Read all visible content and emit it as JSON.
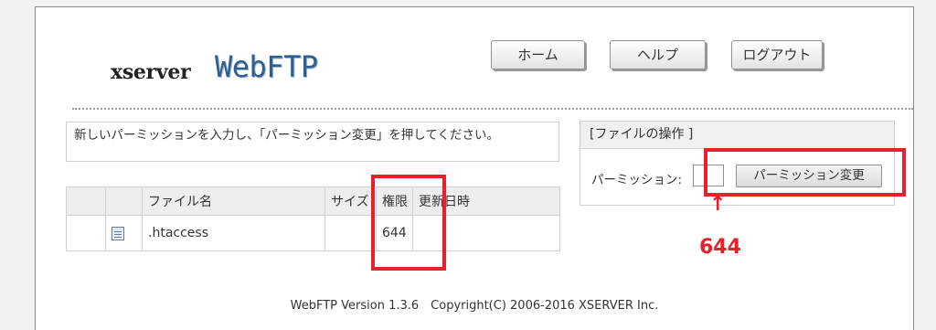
{
  "header": {
    "logo_prefix": "xserver",
    "logo_name": "WebFTP",
    "nav": {
      "home": "ホーム",
      "help": "ヘルプ",
      "logout": "ログアウト"
    }
  },
  "instruction": "新しいパーミッションを入力し、「パーミッション変更」を押してください。",
  "file_ops": {
    "title": "[ファイルの操作 ]",
    "permission_label": "パーミッション:",
    "permission_value": "",
    "change_button": "パーミッション変更"
  },
  "file_table": {
    "columns": [
      "",
      "",
      "ファイル名",
      "サイズ",
      "権限",
      "更新日時"
    ],
    "rows": [
      {
        "checkbox": "",
        "icon": "file-icon",
        "name": ".htaccess",
        "size": "",
        "permission": "644",
        "modified": ""
      }
    ]
  },
  "annotation": {
    "arrow": "↑",
    "value": "644",
    "color": "#e8202a"
  },
  "footer": "WebFTP Version 1.3.6　Copyright(C) 2006-2016 XSERVER Inc."
}
